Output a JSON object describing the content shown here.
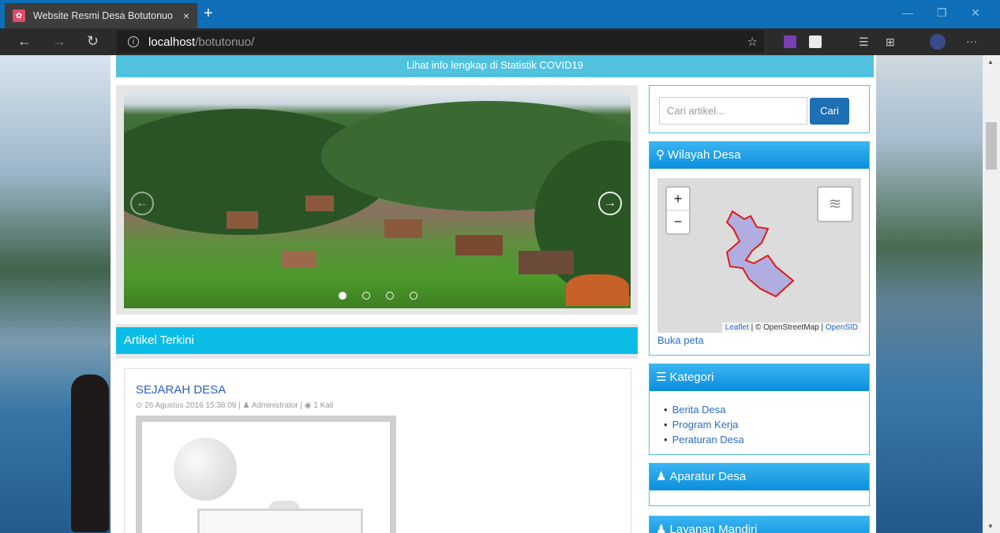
{
  "browser": {
    "tab_title": "Website Resmi Desa Botutonuo",
    "tab_close": "×",
    "new_tab": "+",
    "url_host": "localhost",
    "url_path": "/botutonuo/",
    "win_min": "—",
    "win_max": "❐",
    "win_close": "✕",
    "menu": "···"
  },
  "page": {
    "covid_banner": "Lihat info lengkap di Statistik COVID19",
    "artikel_header": "Artikel Terkini",
    "post": {
      "title": "SEJARAH DESA",
      "meta": "⊙ 26 Agustus 2016 15:38:09 | ♟ Administrator | ◉ 1 Kali"
    }
  },
  "sidebar": {
    "search_placeholder": "Cari artikel...",
    "search_button": "Cari",
    "wilayah_title": "Wilayah Desa",
    "map_attrib_leaflet": "Leaflet",
    "map_attrib_osm": " | © OpenStreetMap | ",
    "map_attrib_opensid": "OpenSID",
    "buka_peta": "Buka peta",
    "kategori_title": "Kategori",
    "kategori_items": [
      "Berita Desa",
      "Program Kerja",
      "Peraturan Desa"
    ],
    "aparatur_title": "Aparatur Desa",
    "layanan_title": "Layanan Mandiri"
  },
  "slider": {
    "dots": 4,
    "active": 0
  }
}
